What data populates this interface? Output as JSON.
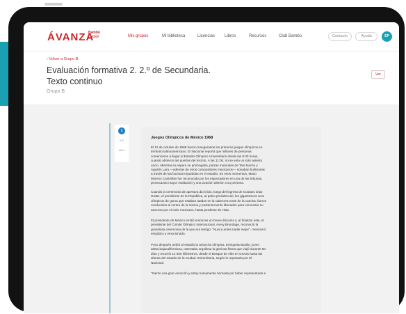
{
  "header": {
    "logo": "ÁVANZA",
    "logo_sub": "Bambú Lector",
    "nav": [
      "Mis grupos",
      "Mi biblioteca",
      "Licencias",
      "Libros",
      "Recursos",
      "Club Bambú"
    ],
    "contact_label": "Contacto",
    "help_label": "Ayuda",
    "avatar_initials": "EP"
  },
  "page": {
    "back_link": "‹ Volver a Grupo B",
    "title_line1": "Evaluación formativa 2. 2.º de Secundaria.",
    "title_line2": "Texto continuo",
    "group": "Grupo B",
    "view_button": "Ver"
  },
  "side_panel": {
    "number": "1",
    "label_a": "A.E",
    "label_b": "años"
  },
  "document": {
    "title": "Juegos Olímpicos de México 1968",
    "paragraphs": [
      "El 12 de octubre de 1968 fueron inaugurados los primeros juegos olímpicos en\nterritorio latinoamericano. El Nacional reportó que millares de personas\ncomenzaron a llegar al Estadio Olímpico Universitario desde las 8:30 horas,\ncuando abrieron las puertas del recinto. A las 11:00, no se veía un solo asiento\nvacío. Mientras la espera se prolongaba, piezas musicales de Tata Nacho y\nAgustín Lara —además de otros compositores mexicanos— sonaban bulliciosas\na través de las bocinas repartidas en el estadio. En esos momentos, Mario\nMoreno Cantinflas fue reconocido por los espectadores en una de las tribunas,\nprovocando mayor exaltación y una ovación alterior a su persona.",
      "Cuando la ceremonia de apertura dio inicio, luego del ingreso de Gustavo Díaz\nOrdaz, el presidente de la República, al palco presidencial, los gigantescos aros\nolímpicos de goma que estaban atados en la cabecera norte de la cancha, fueron\nconducidos al centro de la misma y posteriormente liberados para comenzar su\nascenso por el cielo mexicano, hasta perderse de vista.",
      "El presidente de México emitió entonces un breve discurso y, al finalizar este, el\npresidente del Comité Olímpico Internacional, Avery Brundage, reconoció la\ngrandiosa ceremonia de la que era testigo: \"Nunca antes nadie mejor\", mencionó\nempático y emocionado.",
      "Poco después arribó al estadio la antorcha olímpica. Enriqueta Basilio, joven\natleta bajacaliforniana, ostentaba orgullosa la gloriosa flama que viajó durante 50\ndías y recorrió 14 600 kilómetros, desde el Bosque de Altis en Grecia hasta las\nalturas del estadio de la Ciudad Universitaria, según lo reportado por El\nNacional.",
      "\"Siento una gran emoción y estoy sumamente honrada por haber representado a"
    ]
  },
  "colors": {
    "brand": "#c8262c",
    "accent": "#1b9fb3",
    "frame": "#121212"
  }
}
